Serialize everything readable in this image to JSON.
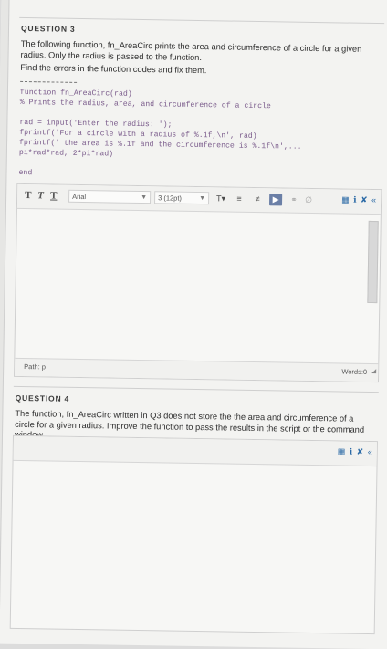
{
  "q3": {
    "title": "QUESTION 3",
    "paragraph1": "The following function, fn_AreaCirc prints the area and circumference of a circle for a given radius. Only the radius is passed to the function.",
    "paragraph2": "Find the errors in the function codes and fix them.",
    "code_lines": [
      "function fn_AreaCirc(rad)",
      "% Prints the radius, area, and circumference of a circle",
      "",
      "rad = input('Enter the radius: ');",
      "fprintf('For a circle with a radius of %.1f,\\n', rad)",
      "fprintf(' the area is %.1f and the circumference is %.1f\\n',...",
      "pi*rad*rad, 2*pi*rad)",
      "",
      "end"
    ],
    "editor": {
      "bold": "T",
      "italic": "T",
      "underline": "T",
      "font_family": "Arial",
      "font_size": "3 (12pt)",
      "status_path": "Path: p",
      "status_words": "Words:0"
    }
  },
  "q4": {
    "title": "QUESTION 4",
    "paragraph": "The function, fn_AreaCirc written in Q3 does not store the the area and circumference of a circle for a given radius. Improve the function to pass the results in the script or the command window."
  },
  "colors": {
    "page": "#f3f3f1",
    "code_text": "#7a5b8b",
    "toolbar_icon": "#6b7fa6",
    "link_blue": "#2b6aa6"
  }
}
